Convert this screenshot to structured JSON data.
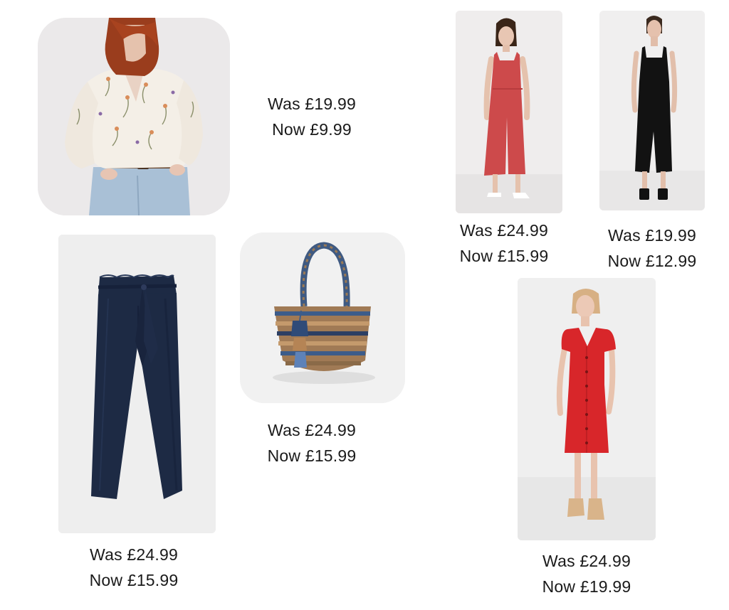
{
  "products": [
    {
      "name": "Floral blouse",
      "was": "Was £19.99",
      "now": "Now £9.99"
    },
    {
      "name": "Red jumpsuit",
      "was": "Was £24.99",
      "now": "Now £15.99"
    },
    {
      "name": "Black midi dress",
      "was": "Was £19.99",
      "now": "Now £12.99"
    },
    {
      "name": "Navy paperbag trousers",
      "was": "Was £24.99",
      "now": "Now £15.99"
    },
    {
      "name": "Woven straw tote bag",
      "was": "Was £24.99",
      "now": "Now £15.99"
    },
    {
      "name": "Red button-front dress",
      "was": "Was £24.99",
      "now": "Now £19.99"
    }
  ],
  "colors": {
    "text": "#1a1a1a",
    "background": "#ffffff",
    "navy": "#1d2a44",
    "red": "#d8262a",
    "coral": "#cd4a4b",
    "black": "#121212"
  }
}
